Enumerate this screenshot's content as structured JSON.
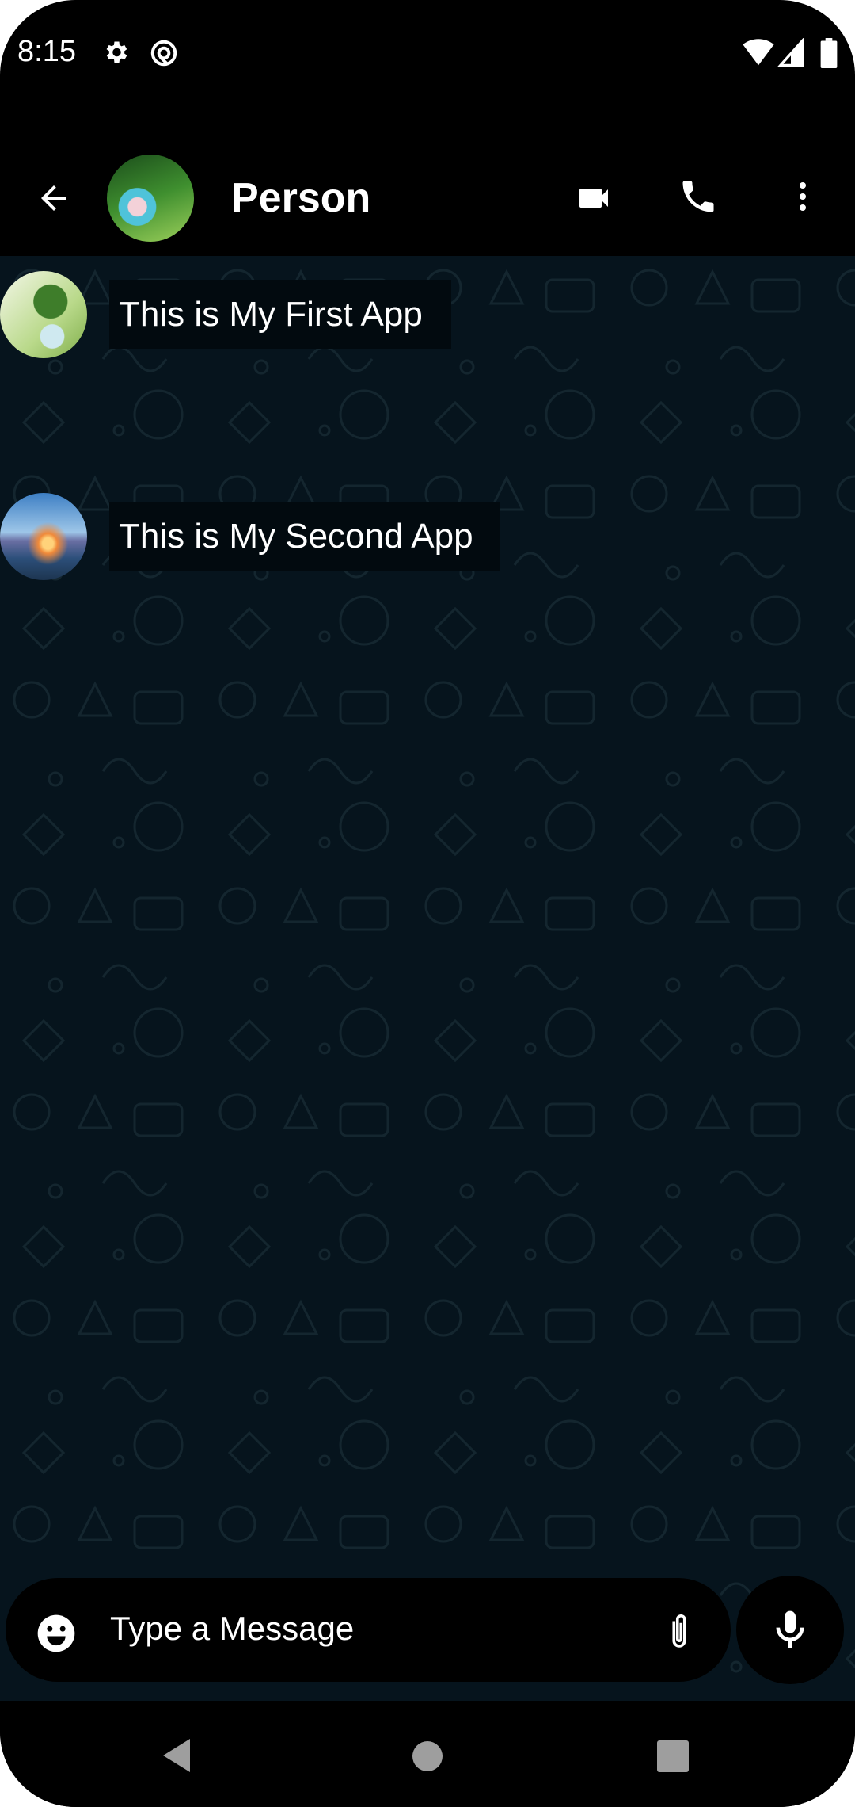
{
  "status_bar": {
    "time": "8:15",
    "icons": [
      "gear-icon",
      "data-saver-icon",
      "wifi-icon",
      "signal-icon",
      "battery-icon"
    ]
  },
  "header": {
    "title": "Person",
    "icons": [
      "back-arrow-icon",
      "video-call-icon",
      "phone-icon",
      "more-vert-icon"
    ]
  },
  "messages": [
    {
      "text": "This is My First App"
    },
    {
      "text": "This is My Second App"
    }
  ],
  "composer": {
    "placeholder": "Type a Message",
    "icons": [
      "emoji-icon",
      "attach-icon",
      "mic-icon"
    ]
  },
  "colors": {
    "chat_background": "#06141d",
    "bubble": "#020a0f",
    "bars": "#000000"
  }
}
